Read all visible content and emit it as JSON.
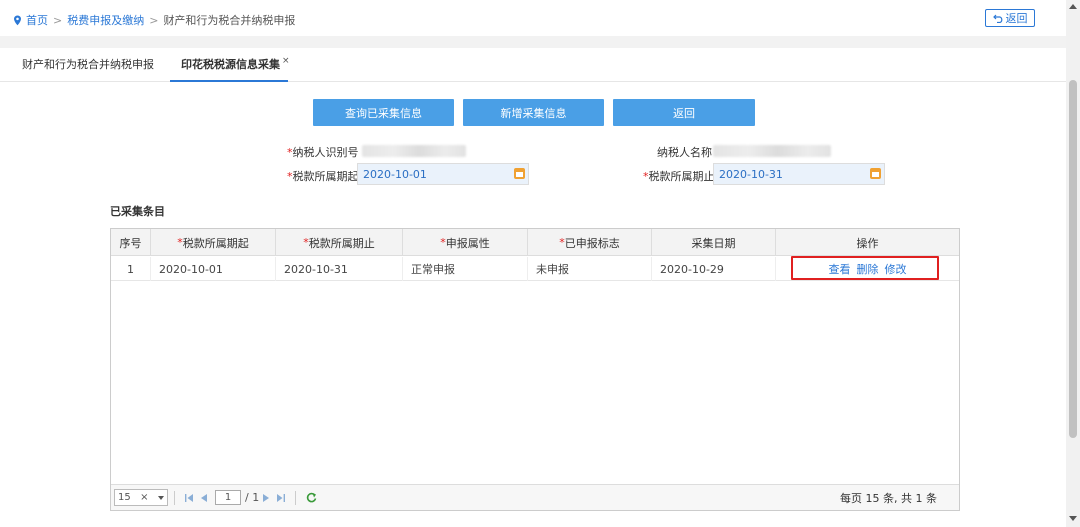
{
  "breadcrumb": {
    "home": "首页",
    "level1": "税费申报及缴纳",
    "level2": "财产和行为税合并纳税申报",
    "separator": ">"
  },
  "back_top_label": "返回",
  "tabs": [
    {
      "label": "财产和行为税合并纳税申报"
    },
    {
      "label": "印花税税源信息采集",
      "close": "×"
    }
  ],
  "actions": {
    "query": "查询已采集信息",
    "add": "新增采集信息",
    "back": "返回"
  },
  "form": {
    "required_mark": "*",
    "taxpayer_id_label": "纳税人识别号",
    "taxpayer_name_label": "纳税人名称",
    "period_start_label": "税款所属期起",
    "period_start_value": "2020-10-01",
    "period_end_label": "税款所属期止",
    "period_end_value": "2020-10-31"
  },
  "section_title": "已采集条目",
  "table": {
    "headers": [
      {
        "label": "序号",
        "required": ""
      },
      {
        "label": "税款所属期起",
        "required": "*"
      },
      {
        "label": "税款所属期止",
        "required": "*"
      },
      {
        "label": "申报属性",
        "required": "*"
      },
      {
        "label": "已申报标志",
        "required": "*"
      },
      {
        "label": "采集日期",
        "required": ""
      },
      {
        "label": "操作",
        "required": ""
      }
    ],
    "rows": [
      {
        "index": "1",
        "start": "2020-10-01",
        "end": "2020-10-31",
        "attr": "正常申报",
        "flag": "未申报",
        "date": "2020-10-29",
        "ops": [
          "查看",
          "删除",
          "修改"
        ]
      }
    ]
  },
  "pager": {
    "page_size": "15",
    "clear": "×",
    "page": "1",
    "total_pages": "/ 1",
    "summary": "每页 15 条, 共 1 条"
  },
  "colors": {
    "accent": "#2b78d6",
    "button": "#4a9fe6",
    "required": "#e02020",
    "highlight_border": "#e02020"
  }
}
